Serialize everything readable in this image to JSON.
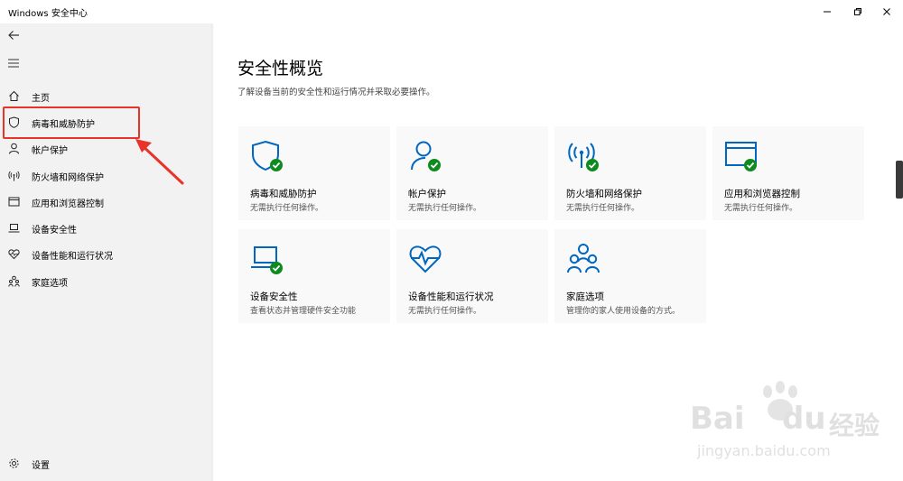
{
  "window": {
    "title": "Windows 安全中心"
  },
  "sidebar": {
    "items": [
      {
        "label": "主页",
        "icon": "home-icon"
      },
      {
        "label": "病毒和威胁防护",
        "icon": "shield-icon"
      },
      {
        "label": "帐户保护",
        "icon": "person-icon"
      },
      {
        "label": "防火墙和网络保护",
        "icon": "wifi-icon"
      },
      {
        "label": "应用和浏览器控制",
        "icon": "app-window-icon"
      },
      {
        "label": "设备安全性",
        "icon": "laptop-icon"
      },
      {
        "label": "设备性能和运行状况",
        "icon": "heart-icon"
      },
      {
        "label": "家庭选项",
        "icon": "family-icon"
      }
    ],
    "settings_label": "设置"
  },
  "main": {
    "title": "安全性概览",
    "subtitle": "了解设备当前的安全性和运行情况并采取必要操作。",
    "cards": [
      {
        "title": "病毒和威胁防护",
        "desc": "无需执行任何操作。",
        "icon": "shield-icon",
        "status": "ok"
      },
      {
        "title": "帐户保护",
        "desc": "无需执行任何操作。",
        "icon": "person-icon",
        "status": "ok"
      },
      {
        "title": "防火墙和网络保护",
        "desc": "无需执行任何操作。",
        "icon": "wifi-icon",
        "status": "ok"
      },
      {
        "title": "应用和浏览器控制",
        "desc": "无需执行任何操作。",
        "icon": "app-window-icon",
        "status": "ok"
      },
      {
        "title": "设备安全性",
        "desc": "查看状态并管理硬件安全功能",
        "icon": "laptop-icon",
        "status": "ok"
      },
      {
        "title": "设备性能和运行状况",
        "desc": "无需执行任何操作。",
        "icon": "heart-icon",
        "status": "none"
      },
      {
        "title": "家庭选项",
        "desc": "管理你的家人使用设备的方式。",
        "icon": "family-icon",
        "status": "none"
      }
    ]
  },
  "watermark": {
    "brand_a": "Bai",
    "brand_b": "du",
    "brand_cn": "经验",
    "url": "jingyan.baidu.com"
  },
  "colors": {
    "accent": "#0067c0",
    "ok_green": "#0f8a1f",
    "annotation_red": "#e8332a"
  }
}
